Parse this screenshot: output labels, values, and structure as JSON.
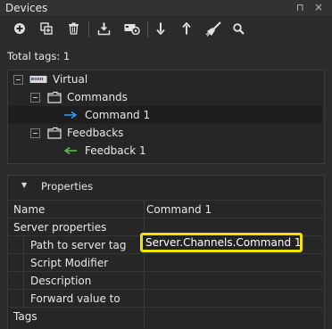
{
  "panel": {
    "title": "Devices",
    "pin_glyph": "⊓",
    "close_glyph": "×"
  },
  "toolbar": {
    "buttons": [
      {
        "name": "add-icon"
      },
      {
        "name": "copy-icon"
      },
      {
        "name": "delete-icon"
      },
      {
        "name": "import-icon"
      },
      {
        "name": "device-settings-icon"
      },
      {
        "name": "move-down-icon"
      },
      {
        "name": "move-up-icon"
      },
      {
        "name": "clear-icon"
      },
      {
        "name": "search-icon"
      }
    ]
  },
  "summary": {
    "total_tags": "Total tags: 1"
  },
  "tree": {
    "root": {
      "label": "Virtual",
      "icon": "device-icon"
    },
    "groups": [
      {
        "label": "Commands",
        "icon": "folder-icon",
        "child": {
          "label": "Command 1",
          "icon": "arrow-right-icon",
          "color": "#3ba4ff"
        }
      },
      {
        "label": "Feedbacks",
        "icon": "folder-icon",
        "child": {
          "label": "Feedback 1",
          "icon": "arrow-left-icon",
          "color": "#5fd14a"
        }
      }
    ]
  },
  "properties": {
    "section_title": "Properties",
    "rows": {
      "name": {
        "label": "Name",
        "value": "Command 1"
      },
      "server_properties": {
        "label": "Server properties"
      },
      "path": {
        "label": "Path to server tag",
        "value": "Server.Channels.Command 1"
      },
      "script": {
        "label": "Script Modifier",
        "value": ""
      },
      "description": {
        "label": "Description",
        "value": ""
      },
      "forward": {
        "label": "Forward value to",
        "value": ""
      },
      "tags": {
        "label": "Tags"
      }
    },
    "highlight_color": "#f2e300"
  }
}
